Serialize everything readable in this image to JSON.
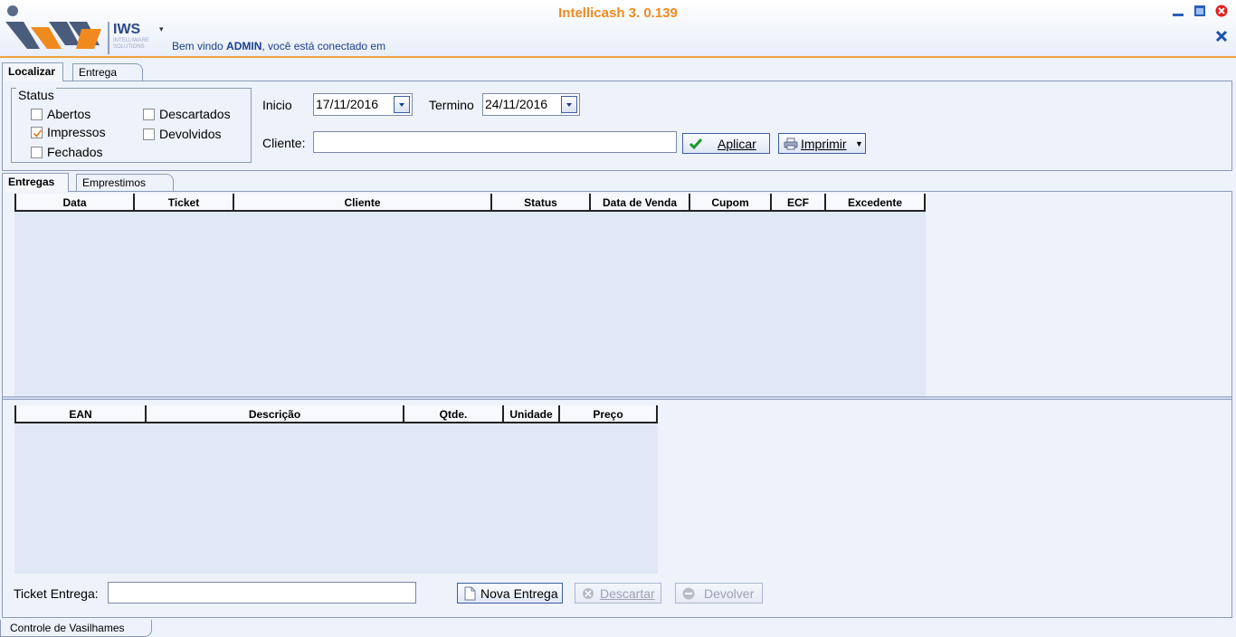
{
  "header": {
    "app_title": "Intellicash 3. 0.139",
    "logo_text": "IWS",
    "logo_sub": "INTELLIWARE SOLUTIONS",
    "welcome_prefix": "Bem vindo ",
    "welcome_user": "ADMIN",
    "welcome_suffix": ", você está conectado em",
    "window_buttons": [
      "minimize-icon",
      "maximize-icon",
      "close-icon"
    ],
    "close_tab_icon": "x-icon"
  },
  "main_tabs": [
    {
      "label": "Localizar",
      "active": true
    },
    {
      "label": "Entrega",
      "active": false
    }
  ],
  "filters": {
    "status_legend": "Status",
    "checkboxes": [
      {
        "label": "Abertos",
        "checked": false
      },
      {
        "label": "Impressos",
        "checked": true
      },
      {
        "label": "Fechados",
        "checked": false
      },
      {
        "label": "Descartados",
        "checked": false
      },
      {
        "label": "Devolvidos",
        "checked": false
      }
    ],
    "inicio_label": "Inicio",
    "inicio_value": "17/11/2016",
    "termino_label": "Termino",
    "termino_value": "24/11/2016",
    "cliente_label": "Cliente:",
    "cliente_value": "",
    "aplicar_label": "Aplicar",
    "imprimir_label": "Imprimir"
  },
  "sub_tabs": [
    {
      "label": "Entregas",
      "active": true
    },
    {
      "label": "Emprestimos",
      "active": false
    }
  ],
  "entregas_table": {
    "columns": [
      "Data",
      "Ticket",
      "Cliente",
      "Status",
      "Data de Venda",
      "Cupom",
      "ECF",
      "Excedente"
    ],
    "rows": []
  },
  "items_table": {
    "columns": [
      "EAN",
      "Descrição",
      "Qtde.",
      "Unidade",
      "Preço"
    ],
    "rows": []
  },
  "footer_actions": {
    "ticket_label": "Ticket Entrega:",
    "ticket_value": "",
    "nova_entrega": "Nova Entrega",
    "descartar": "Descartar",
    "devolver": "Devolver"
  },
  "bottom_tab": "Controle de Vasilhames",
  "colors": {
    "title": "#f08a1e",
    "accent_line": "#f0a040",
    "welcome_text": "#1a3f8c",
    "grid_bg": "#e0e8f8"
  }
}
